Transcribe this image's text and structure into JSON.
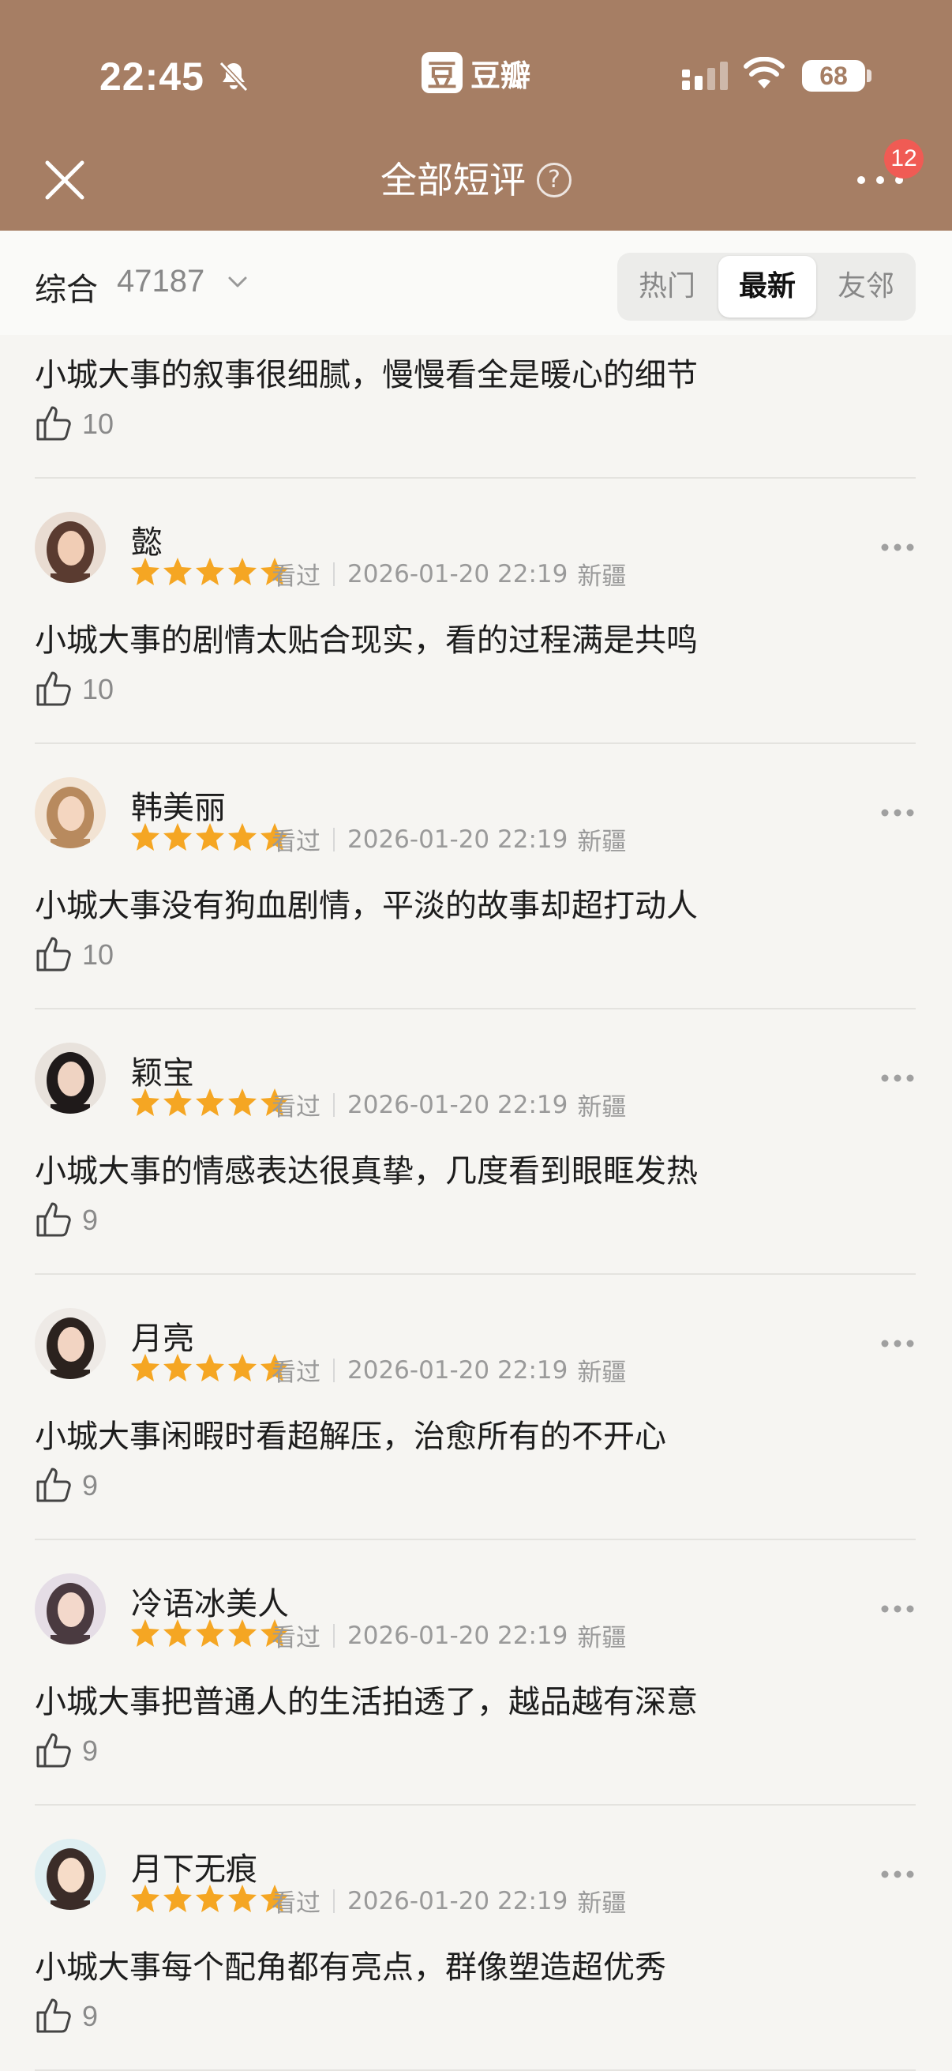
{
  "status_bar": {
    "time": "22:45",
    "battery": "68"
  },
  "app": {
    "logo_char": "豆",
    "name": "豆瓣"
  },
  "header": {
    "title": "全部短评",
    "help": "?",
    "notification_count": "12"
  },
  "filter": {
    "sort_label": "综合",
    "count": "47187",
    "tabs": [
      {
        "label": "热门",
        "active": false
      },
      {
        "label": "最新",
        "active": true
      },
      {
        "label": "友邻",
        "active": false
      }
    ]
  },
  "first_review": {
    "text": "小城大事的叙事很细腻，慢慢看全是暖心的细节",
    "likes": "10"
  },
  "reviews": [
    {
      "user": "懿",
      "rating": 5,
      "status": "看过",
      "time": "2026-01-20 22:19",
      "location": "新疆",
      "text": "小城大事的剧情太贴合现实，看的过程满是共鸣",
      "likes": "10"
    },
    {
      "user": "韩美丽",
      "rating": 5,
      "status": "看过",
      "time": "2026-01-20 22:19",
      "location": "新疆",
      "text": "小城大事没有狗血剧情，平淡的故事却超打动人",
      "likes": "10"
    },
    {
      "user": "颖宝",
      "rating": 5,
      "status": "看过",
      "time": "2026-01-20 22:19",
      "location": "新疆",
      "text": "小城大事的情感表达很真挚，几度看到眼眶发热",
      "likes": "9"
    },
    {
      "user": "月亮",
      "rating": 5,
      "status": "看过",
      "time": "2026-01-20 22:19",
      "location": "新疆",
      "text": "小城大事闲暇时看超解压，治愈所有的不开心",
      "likes": "9"
    },
    {
      "user": "冷语冰美人",
      "rating": 5,
      "status": "看过",
      "time": "2026-01-20 22:19",
      "location": "新疆",
      "text": "小城大事把普通人的生活拍透了，越品越有深意",
      "likes": "9"
    },
    {
      "user": "月下无痕",
      "rating": 5,
      "status": "看过",
      "time": "2026-01-20 22:19",
      "location": "新疆",
      "text": "小城大事每个配角都有亮点，群像塑造超优秀",
      "likes": "9"
    }
  ],
  "colors": {
    "header": "#a67e64",
    "star": "#f5a623",
    "badge": "#f05b54"
  }
}
